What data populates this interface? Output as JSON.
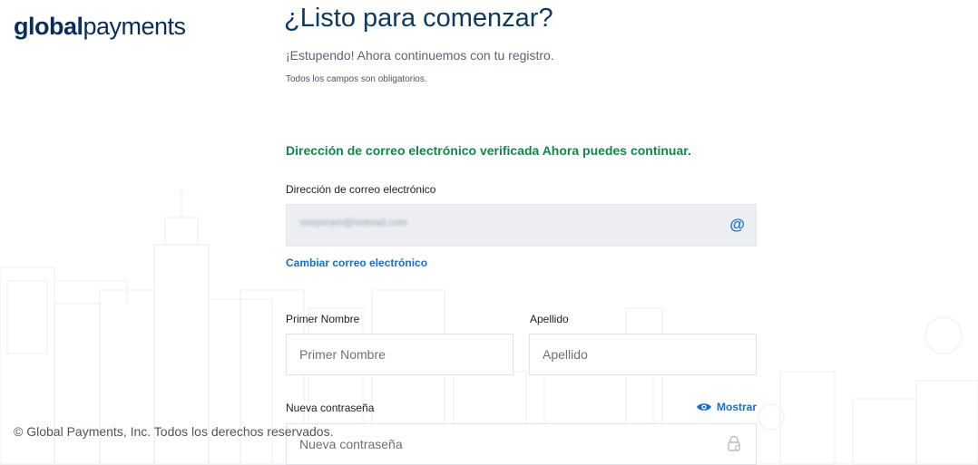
{
  "brand": {
    "logo_bold": "global",
    "logo_light": "payments"
  },
  "header": {
    "title": "¿Listo para comenzar?",
    "subtitle": "¡Estupendo! Ahora continuemos con tu registro.",
    "required_note": "Todos los campos son obligatorios."
  },
  "verification": {
    "message": "Dirección de correo electrónico verificada Ahora puedes continuar."
  },
  "email": {
    "label": "Dirección de correo electrónico",
    "value": "vireyeram@hotmail.com",
    "icon": "at-icon",
    "change_link": "Cambiar correo electrónico"
  },
  "first_name": {
    "label": "Primer Nombre",
    "placeholder": "Primer Nombre"
  },
  "last_name": {
    "label": "Apellido",
    "placeholder": "Apellido"
  },
  "password": {
    "label": "Nueva contraseña",
    "placeholder": "Nueva contraseña",
    "show_label": "Mostrar",
    "show_icon": "eye-icon",
    "lock_icon": "lock-icon"
  },
  "footer": {
    "copyright": "© Global Payments, Inc. Todos los derechos reservados."
  },
  "colors": {
    "brand_navy": "#0b2d5b",
    "accent_blue": "#1a6fc4",
    "success_green": "#0d8a4a"
  }
}
